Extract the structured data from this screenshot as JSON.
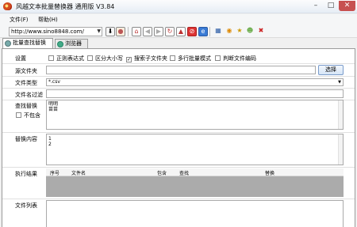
{
  "window": {
    "title": "风越文本批量替换器 通用版 V3.84"
  },
  "menu": {
    "file": "文件(F)",
    "help": "帮助(H)"
  },
  "toolbar": {
    "url": "http://www.sino8848.com/"
  },
  "tabs": [
    {
      "label": "批量查找替换"
    },
    {
      "label": "浏览器"
    }
  ],
  "settings": {
    "label": "设置",
    "options": [
      {
        "label": "正则表达式",
        "checked": false
      },
      {
        "label": "区分大小写",
        "checked": false
      },
      {
        "label": "搜索子文件夹",
        "checked": true
      },
      {
        "label": "多行批量模式",
        "checked": false
      },
      {
        "label": "判断文件编码",
        "checked": false
      }
    ]
  },
  "source_folder": {
    "label": "源文件夹",
    "value": "",
    "button": "选择"
  },
  "file_type": {
    "label": "文件类型",
    "value": "*.csv"
  },
  "filename_filter": {
    "label": "文件名过滤",
    "value": ""
  },
  "find_replace": {
    "label": "查找替换",
    "exclude_label": "不包含",
    "lines": [
      "明明",
      "苗苗"
    ]
  },
  "replace_content": {
    "label": "替换内容",
    "lines": [
      "1",
      "2"
    ]
  },
  "results": {
    "label": "执行结果",
    "columns": [
      "序号",
      "文件名",
      "包含",
      "查找",
      "替换"
    ]
  },
  "file_list": {
    "label": "文件列表"
  }
}
